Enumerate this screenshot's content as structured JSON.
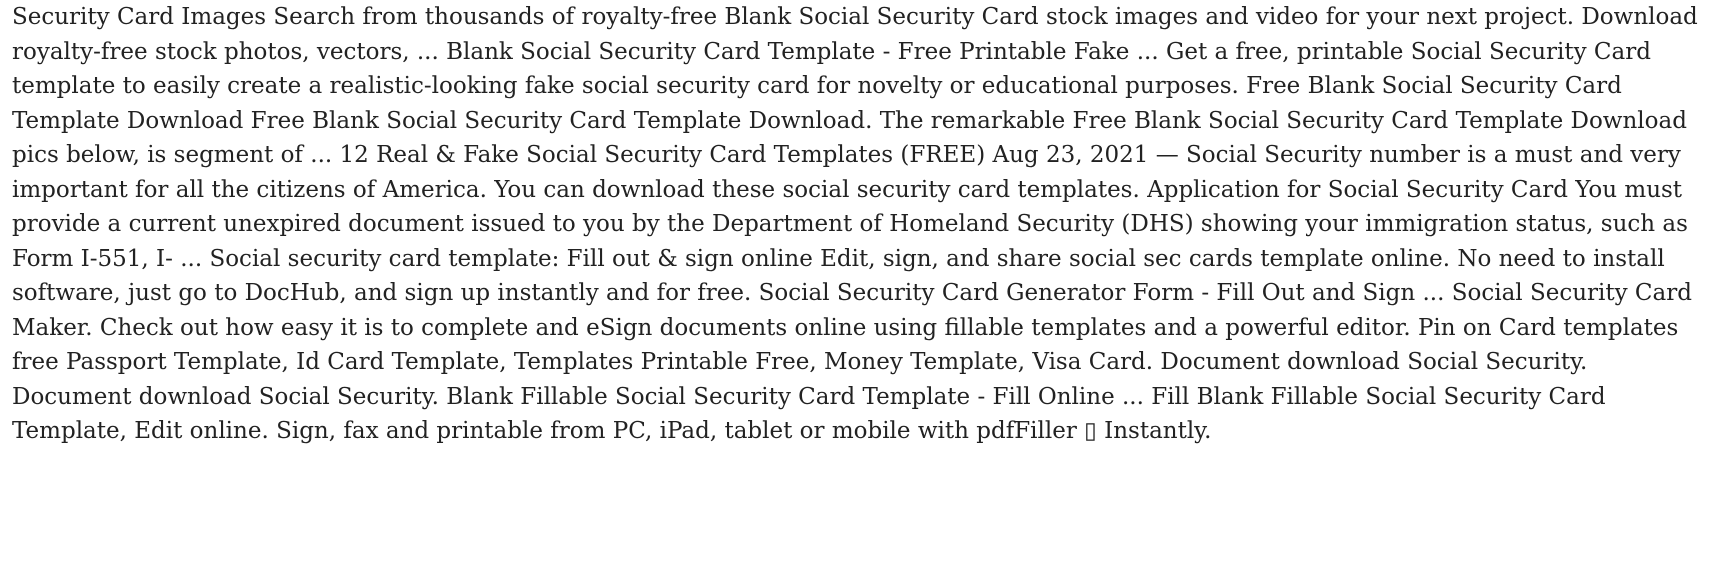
{
  "document": {
    "paragraph": "Security Card Images Search from thousands of royalty-free Blank Social Security Card stock images and video for your next project. Download royalty-free stock photos, vectors, ... Blank Social Security Card Template - Free Printable Fake ... Get a free, printable Social Security Card template to easily create a realistic-looking fake social security card for novelty or educational purposes. Free Blank Social Security Card Template Download Free Blank Social Security Card Template Download. The remarkable Free Blank Social Security Card Template Download pics below, is segment of ... 12 Real & Fake Social Security Card Templates (FREE) Aug 23, 2021 — Social Security number is a must and very important for all the citizens of America. You can download these social security card templates. Application for Social Security Card You must provide a current unexpired document issued to you by the Department of Homeland Security (DHS) showing your immigration status, such as Form I-551, I- ... Social security card template: Fill out & sign online Edit, sign, and share social sec cards template online. No need to install software, just go to DocHub, and sign up instantly and for free. Social Security Card Generator Form - Fill Out and Sign ... Social Security Card Maker. Check out how easy it is to complete and eSign documents online using fillable templates and a powerful editor. Pin on Card templates free Passport Template, Id Card Template, Templates Printable Free, Money Template, Visa Card. Document download Social Security. Document download Social Security. Blank Fillable Social Security Card Template - Fill Online ... Fill Blank Fillable Social Security Card Template, Edit online. Sign, fax and printable from PC, iPad, tablet or mobile with pdfFiller ▯ Instantly."
  },
  "colors": {
    "background": "#ffffff",
    "text": "#222222"
  }
}
